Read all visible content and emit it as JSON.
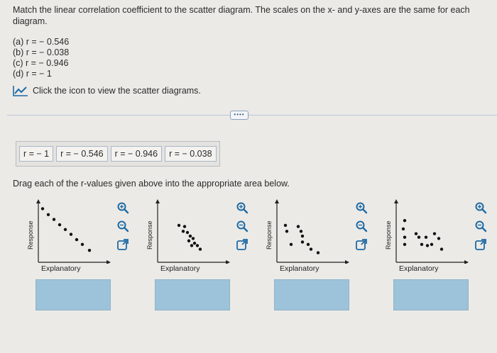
{
  "question": "Match the linear correlation coefficient to the scatter diagram. The scales on the x- and y-axes are the same for each diagram.",
  "options": [
    "(a) r = − 0.546",
    "(b) r = − 0.038",
    "(c) r = − 0.946",
    "(d) r = − 1"
  ],
  "view_link": "Click the icon to view the scatter diagrams.",
  "divider_button": "••••",
  "chips": [
    "r = − 1",
    "r = − 0.546",
    "r = − 0.946",
    "r = − 0.038"
  ],
  "drag_instruction": "Drag each of the r-values given above into the appropriate area below.",
  "plots": [
    {
      "ylabel": "Response",
      "xlabel": "Explanatory",
      "points": [
        [
          0.06,
          0.9
        ],
        [
          0.14,
          0.8
        ],
        [
          0.22,
          0.72
        ],
        [
          0.3,
          0.63
        ],
        [
          0.38,
          0.55
        ],
        [
          0.46,
          0.47
        ],
        [
          0.54,
          0.38
        ],
        [
          0.62,
          0.3
        ],
        [
          0.72,
          0.2
        ]
      ]
    },
    {
      "ylabel": "Response",
      "xlabel": "Explanatory",
      "points": [
        [
          0.3,
          0.62
        ],
        [
          0.38,
          0.6
        ],
        [
          0.36,
          0.52
        ],
        [
          0.42,
          0.5
        ],
        [
          0.46,
          0.44
        ],
        [
          0.5,
          0.4
        ],
        [
          0.44,
          0.36
        ],
        [
          0.52,
          0.32
        ],
        [
          0.56,
          0.28
        ],
        [
          0.6,
          0.22
        ],
        [
          0.48,
          0.28
        ]
      ]
    },
    {
      "ylabel": "Response",
      "xlabel": "Explanatory",
      "points": [
        [
          0.12,
          0.62
        ],
        [
          0.14,
          0.52
        ],
        [
          0.3,
          0.6
        ],
        [
          0.34,
          0.52
        ],
        [
          0.36,
          0.44
        ],
        [
          0.36,
          0.34
        ],
        [
          0.44,
          0.3
        ],
        [
          0.48,
          0.22
        ],
        [
          0.58,
          0.16
        ],
        [
          0.2,
          0.3
        ]
      ]
    },
    {
      "ylabel": "Response",
      "xlabel": "Explanatory",
      "points": [
        [
          0.12,
          0.7
        ],
        [
          0.1,
          0.56
        ],
        [
          0.12,
          0.42
        ],
        [
          0.12,
          0.3
        ],
        [
          0.28,
          0.48
        ],
        [
          0.32,
          0.42
        ],
        [
          0.42,
          0.42
        ],
        [
          0.36,
          0.3
        ],
        [
          0.44,
          0.28
        ],
        [
          0.5,
          0.3
        ],
        [
          0.54,
          0.48
        ],
        [
          0.6,
          0.4
        ],
        [
          0.64,
          0.22
        ]
      ]
    }
  ],
  "colors": {
    "drop_zone": "#9cc3d9",
    "icon_blue": "#1d6aa5"
  }
}
